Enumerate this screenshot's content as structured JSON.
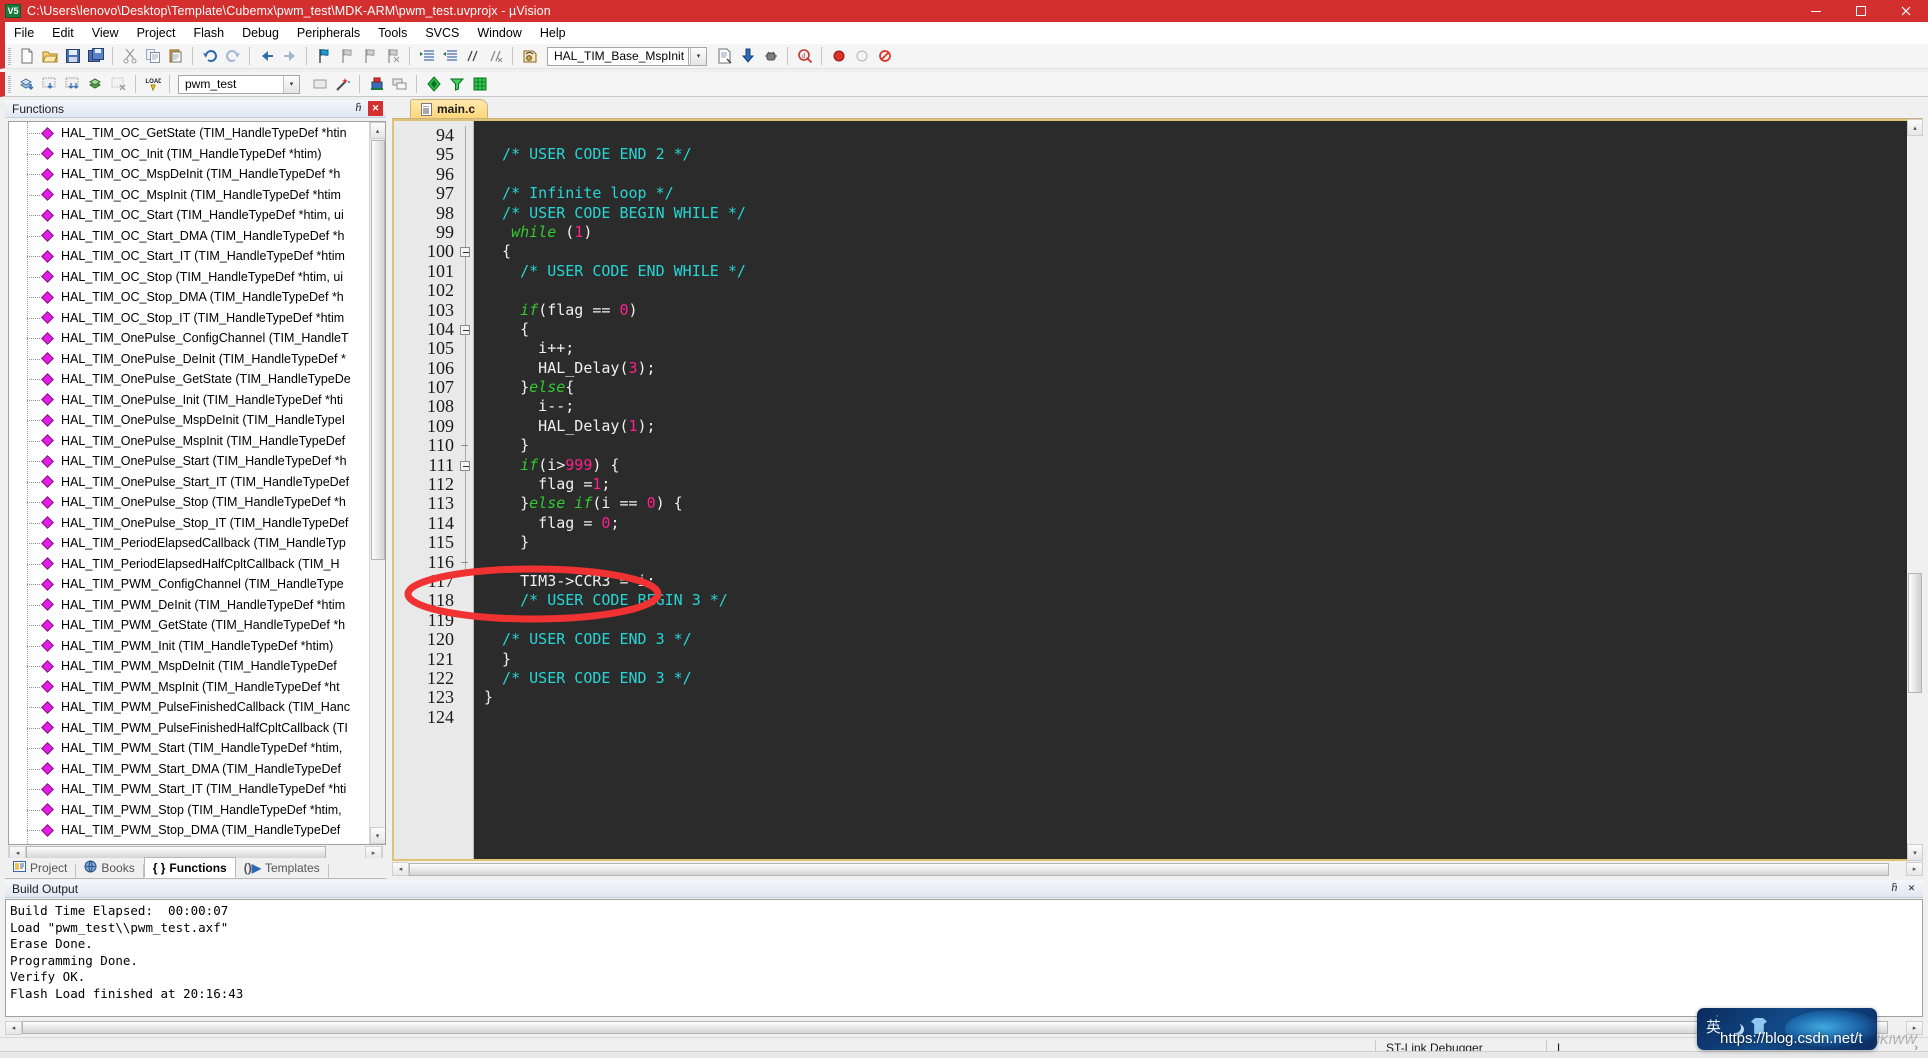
{
  "window": {
    "title": "C:\\Users\\lenovo\\Desktop\\Template\\Cubemx\\pwm_test\\MDK-ARM\\pwm_test.uvprojx - µVision",
    "logo_text": "V5",
    "minimize_label": "─",
    "maximize_label": "❐",
    "close_label": "✕"
  },
  "menu": {
    "items": [
      {
        "label": "File"
      },
      {
        "label": "Edit"
      },
      {
        "label": "View"
      },
      {
        "label": "Project"
      },
      {
        "label": "Flash"
      },
      {
        "label": "Debug"
      },
      {
        "label": "Peripherals"
      },
      {
        "label": "Tools"
      },
      {
        "label": "SVCS"
      },
      {
        "label": "Window"
      },
      {
        "label": "Help"
      }
    ]
  },
  "toolbar_main": {
    "function_combo_value": "HAL_TIM_Base_MspInit",
    "dropdown_arrow": "▾",
    "icons": [
      "new-file-icon",
      "open-file-icon",
      "save-icon",
      "save-all-icon",
      "cut-icon",
      "copy-icon",
      "paste-icon",
      "undo-icon",
      "redo-icon",
      "navigate-back-icon",
      "navigate-forward-icon",
      "bookmark-toggle-icon",
      "bookmark-prev-icon",
      "bookmark-next-icon",
      "bookmark-clear-icon",
      "indent-increase-icon",
      "indent-decrease-icon",
      "comment-icon",
      "uncomment-icon",
      "function-browse-icon",
      "insert-file-icon",
      "download-icon",
      "debug-settings-icon",
      "find-in-files-icon",
      "breakpoint-insert-icon",
      "breakpoint-disable-icon",
      "breakpoint-kill-all-icon"
    ]
  },
  "toolbar_build": {
    "project_combo_value": "pwm_test",
    "dropdown_arrow": "▾",
    "icons": [
      "translate-icon",
      "build-icon",
      "rebuild-icon",
      "batch-build-icon",
      "stop-build-icon",
      "load-icon",
      "target-options-icon",
      "magic-wand-icon",
      "manage-project-items-icon",
      "multi-project-icon",
      "pack-installer-icon",
      "filter-icon",
      "pack-manage-icon"
    ]
  },
  "functions_panel": {
    "caption": "Functions",
    "pin_label": "ⴌ",
    "close_label": "✕",
    "items": [
      "HAL_TIM_OC_GetState (TIM_HandleTypeDef *htin",
      "HAL_TIM_OC_Init (TIM_HandleTypeDef *htim)",
      "HAL_TIM_OC_MspDeInit (TIM_HandleTypeDef *h",
      "HAL_TIM_OC_MspInit (TIM_HandleTypeDef *htim",
      "HAL_TIM_OC_Start (TIM_HandleTypeDef *htim, ui",
      "HAL_TIM_OC_Start_DMA (TIM_HandleTypeDef *h",
      "HAL_TIM_OC_Start_IT (TIM_HandleTypeDef *htim",
      "HAL_TIM_OC_Stop (TIM_HandleTypeDef *htim, ui",
      "HAL_TIM_OC_Stop_DMA (TIM_HandleTypeDef *h",
      "HAL_TIM_OC_Stop_IT (TIM_HandleTypeDef *htim",
      "HAL_TIM_OnePulse_ConfigChannel (TIM_HandleT",
      "HAL_TIM_OnePulse_DeInit (TIM_HandleTypeDef *",
      "HAL_TIM_OnePulse_GetState (TIM_HandleTypeDe",
      "HAL_TIM_OnePulse_Init (TIM_HandleTypeDef *hti",
      "HAL_TIM_OnePulse_MspDeInit (TIM_HandleTypeI",
      "HAL_TIM_OnePulse_MspInit (TIM_HandleTypeDef",
      "HAL_TIM_OnePulse_Start (TIM_HandleTypeDef *h",
      "HAL_TIM_OnePulse_Start_IT (TIM_HandleTypeDef",
      "HAL_TIM_OnePulse_Stop (TIM_HandleTypeDef *h",
      "HAL_TIM_OnePulse_Stop_IT (TIM_HandleTypeDef",
      "HAL_TIM_PeriodElapsedCallback (TIM_HandleTyp",
      "HAL_TIM_PeriodElapsedHalfCpltCallback (TIM_H",
      "HAL_TIM_PWM_ConfigChannel (TIM_HandleType",
      "HAL_TIM_PWM_DeInit (TIM_HandleTypeDef *htim",
      "HAL_TIM_PWM_GetState (TIM_HandleTypeDef *h",
      "HAL_TIM_PWM_Init (TIM_HandleTypeDef *htim)",
      "HAL_TIM_PWM_MspDeInit (TIM_HandleTypeDef",
      "HAL_TIM_PWM_MspInit (TIM_HandleTypeDef *ht",
      "HAL_TIM_PWM_PulseFinishedCallback (TIM_Hanc",
      "HAL_TIM_PWM_PulseFinishedHalfCpltCallback (TI",
      "HAL_TIM_PWM_Start (TIM_HandleTypeDef *htim,",
      "HAL_TIM_PWM_Start_DMA (TIM_HandleTypeDef",
      "HAL_TIM_PWM_Start_IT (TIM_HandleTypeDef *hti",
      "HAL_TIM_PWM_Stop (TIM_HandleTypeDef *htim,",
      "HAL_TIM_PWM_Stop_DMA (TIM_HandleTypeDef",
      "HAL_TIM_PWM_Stop_IT (TIM_HandleTypeDef *hti"
    ],
    "scroll_up": "▴",
    "scroll_down": "▾",
    "scroll_left": "◂",
    "scroll_right": "▸"
  },
  "left_tabs": {
    "items": [
      {
        "label": "Project",
        "icon": "project-icon",
        "active": false
      },
      {
        "label": "Books",
        "icon": "books-icon",
        "active": false
      },
      {
        "label": "Functions",
        "icon": "functions-braces-icon",
        "active": true
      },
      {
        "label": "Templates",
        "icon": "templates-icon",
        "active": false
      }
    ]
  },
  "editor": {
    "tab_label": "main.c",
    "tab_icon": "c-file-icon",
    "first_line_number": 94,
    "lines": [
      {
        "n": 94,
        "fold": "none",
        "tokens": []
      },
      {
        "n": 95,
        "fold": "none",
        "tokens": [
          {
            "t": "com",
            "v": "  /* USER CODE END 2 */"
          }
        ]
      },
      {
        "n": 96,
        "fold": "none",
        "tokens": []
      },
      {
        "n": 97,
        "fold": "none",
        "tokens": [
          {
            "t": "com",
            "v": "  /* Infinite loop */"
          }
        ]
      },
      {
        "n": 98,
        "fold": "none",
        "tokens": [
          {
            "t": "com",
            "v": "  /* USER CODE BEGIN WHILE */"
          }
        ]
      },
      {
        "n": 99,
        "fold": "none",
        "tokens": [
          {
            "t": "kw",
            "v": "   while"
          },
          {
            "t": "txt",
            "v": " ("
          },
          {
            "t": "num",
            "v": "1"
          },
          {
            "t": "txt",
            "v": ")"
          }
        ]
      },
      {
        "n": 100,
        "fold": "box",
        "tokens": [
          {
            "t": "txt",
            "v": "  {"
          }
        ]
      },
      {
        "n": 101,
        "fold": "line",
        "tokens": [
          {
            "t": "com",
            "v": "    /* USER CODE END WHILE */"
          }
        ]
      },
      {
        "n": 102,
        "fold": "line",
        "tokens": []
      },
      {
        "n": 103,
        "fold": "line",
        "tokens": [
          {
            "t": "kw",
            "v": "    if"
          },
          {
            "t": "txt",
            "v": "(flag == "
          },
          {
            "t": "num",
            "v": "0"
          },
          {
            "t": "txt",
            "v": ")"
          }
        ]
      },
      {
        "n": 104,
        "fold": "box",
        "tokens": [
          {
            "t": "txt",
            "v": "    {"
          }
        ]
      },
      {
        "n": 105,
        "fold": "line",
        "tokens": [
          {
            "t": "txt",
            "v": "      i++;"
          }
        ]
      },
      {
        "n": 106,
        "fold": "line",
        "tokens": [
          {
            "t": "txt",
            "v": "      HAL_Delay("
          },
          {
            "t": "num",
            "v": "3"
          },
          {
            "t": "txt",
            "v": ");"
          }
        ]
      },
      {
        "n": 107,
        "fold": "line",
        "tokens": [
          {
            "t": "txt",
            "v": "    }"
          },
          {
            "t": "kw",
            "v": "else"
          },
          {
            "t": "txt",
            "v": "{"
          }
        ]
      },
      {
        "n": 108,
        "fold": "line",
        "tokens": [
          {
            "t": "txt",
            "v": "      i--;"
          }
        ]
      },
      {
        "n": 109,
        "fold": "line",
        "tokens": [
          {
            "t": "txt",
            "v": "      HAL_Delay("
          },
          {
            "t": "num",
            "v": "1"
          },
          {
            "t": "txt",
            "v": ");"
          }
        ]
      },
      {
        "n": 110,
        "fold": "tick",
        "tokens": [
          {
            "t": "txt",
            "v": "    }"
          }
        ]
      },
      {
        "n": 111,
        "fold": "box",
        "tokens": [
          {
            "t": "kw",
            "v": "    if"
          },
          {
            "t": "txt",
            "v": "(i>"
          },
          {
            "t": "num",
            "v": "999"
          },
          {
            "t": "txt",
            "v": ") {"
          }
        ]
      },
      {
        "n": 112,
        "fold": "line",
        "tokens": [
          {
            "t": "txt",
            "v": "      flag ="
          },
          {
            "t": "num",
            "v": "1"
          },
          {
            "t": "txt",
            "v": ";"
          }
        ]
      },
      {
        "n": 113,
        "fold": "line",
        "tokens": [
          {
            "t": "txt",
            "v": "    }"
          },
          {
            "t": "kw",
            "v": "else if"
          },
          {
            "t": "txt",
            "v": "(i == "
          },
          {
            "t": "num",
            "v": "0"
          },
          {
            "t": "txt",
            "v": ") {"
          }
        ]
      },
      {
        "n": 114,
        "fold": "line",
        "tokens": [
          {
            "t": "txt",
            "v": "      flag = "
          },
          {
            "t": "num",
            "v": "0"
          },
          {
            "t": "txt",
            "v": ";"
          }
        ]
      },
      {
        "n": 115,
        "fold": "line",
        "tokens": [
          {
            "t": "txt",
            "v": "    }"
          }
        ]
      },
      {
        "n": 116,
        "fold": "tick",
        "tokens": []
      },
      {
        "n": 117,
        "fold": "none",
        "tokens": [
          {
            "t": "txt",
            "v": "    TIM3->CCR3 = i;"
          }
        ]
      },
      {
        "n": 118,
        "fold": "none",
        "tokens": [
          {
            "t": "com",
            "v": "    /* USER CODE BEGIN 3 */"
          }
        ]
      },
      {
        "n": 119,
        "fold": "none",
        "tokens": []
      },
      {
        "n": 120,
        "fold": "none",
        "tokens": [
          {
            "t": "com",
            "v": "  /* USER CODE END 3 */"
          }
        ]
      },
      {
        "n": 121,
        "fold": "none",
        "tokens": [
          {
            "t": "txt",
            "v": "  }"
          }
        ]
      },
      {
        "n": 122,
        "fold": "none",
        "tokens": [
          {
            "t": "com",
            "v": "  /* USER CODE END 3 */"
          }
        ]
      },
      {
        "n": 123,
        "fold": "none",
        "tokens": [
          {
            "t": "txt",
            "v": "}"
          }
        ]
      },
      {
        "n": 124,
        "fold": "none",
        "tokens": []
      }
    ],
    "annotation": {
      "shape": "ellipse",
      "color": "#f03232",
      "around_line": 117
    }
  },
  "build_output": {
    "caption": "Build Output",
    "pin_label": "ⴌ",
    "close_label": "✕",
    "lines": [
      "Build Time Elapsed:  00:00:07",
      "Load \"pwm_test\\\\pwm_test.axf\"",
      "Erase Done.",
      "Programming Done.",
      "Verify OK.",
      "Flash Load finished at 20:16:43"
    ]
  },
  "statusbar": {
    "debugger": "ST-Link Debugger",
    "right_cell": "L"
  },
  "overlay": {
    "ime_char": "英",
    "url": "https://blog.csdn.net/t",
    "faint": "WIKIWW"
  },
  "colors": {
    "title_red": "#d32f2f",
    "editor_bg": "#2b2b2b",
    "comment_cyan": "#26d6d6",
    "keyword_green": "#30cc30",
    "number_pink": "#ff1f8f",
    "annotation_red": "#f03232",
    "tab_yellow": "#ffd77b"
  }
}
